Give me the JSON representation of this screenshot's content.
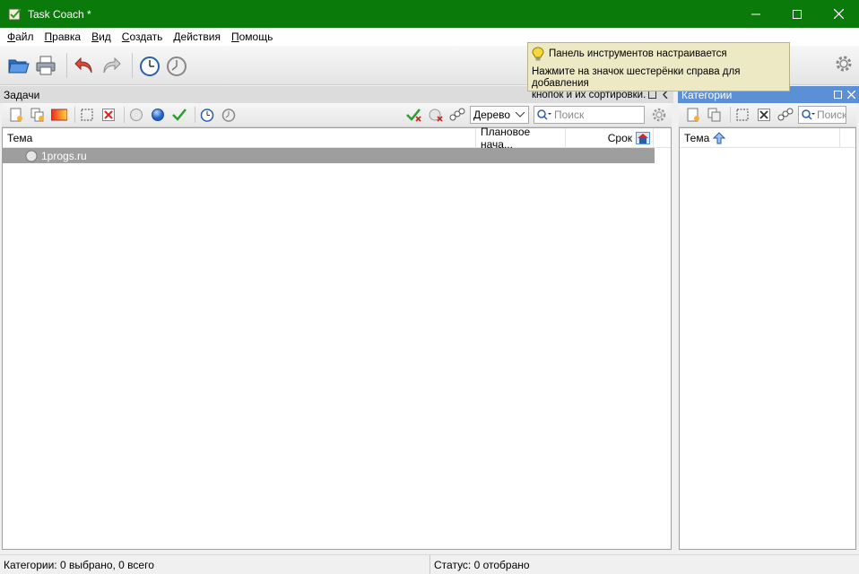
{
  "window": {
    "title": "Task Coach *"
  },
  "menu": {
    "items": [
      {
        "key": "Ф",
        "rest": "айл"
      },
      {
        "key": "П",
        "rest": "равка"
      },
      {
        "key": "В",
        "rest": "ид"
      },
      {
        "key": "С",
        "rest": "оздать"
      },
      {
        "key": "Д",
        "rest": "ействия"
      },
      {
        "key": "П",
        "rest": "омощь"
      }
    ]
  },
  "tooltip": {
    "title": "Панель инструментов настраивается",
    "body_line1": "Нажмите на значок шестерёнки справа для добавления",
    "body_line2": "кнопок и их сортировки."
  },
  "tasks_pane": {
    "title": "Задачи",
    "view_select": "Дерево",
    "search_placeholder": "Поиск",
    "columns": {
      "subject": "Тема",
      "planned_start": "Плановое нача...",
      "due": "Срок"
    },
    "rows": [
      {
        "subject": "1progs.ru"
      }
    ]
  },
  "categories_pane": {
    "title": "Категории",
    "search_placeholder": "Поиск",
    "columns": {
      "subject": "Тема"
    }
  },
  "status": {
    "categories": "Категории: 0 выбрано, 0 всего",
    "status": "Статус: 0 отобрано"
  },
  "colors": {
    "titlebar": "#0a7a0a",
    "categories_header": "#5b8fd6",
    "selected_row": "#9e9e9e",
    "tooltip_bg": "#ece9c4"
  }
}
